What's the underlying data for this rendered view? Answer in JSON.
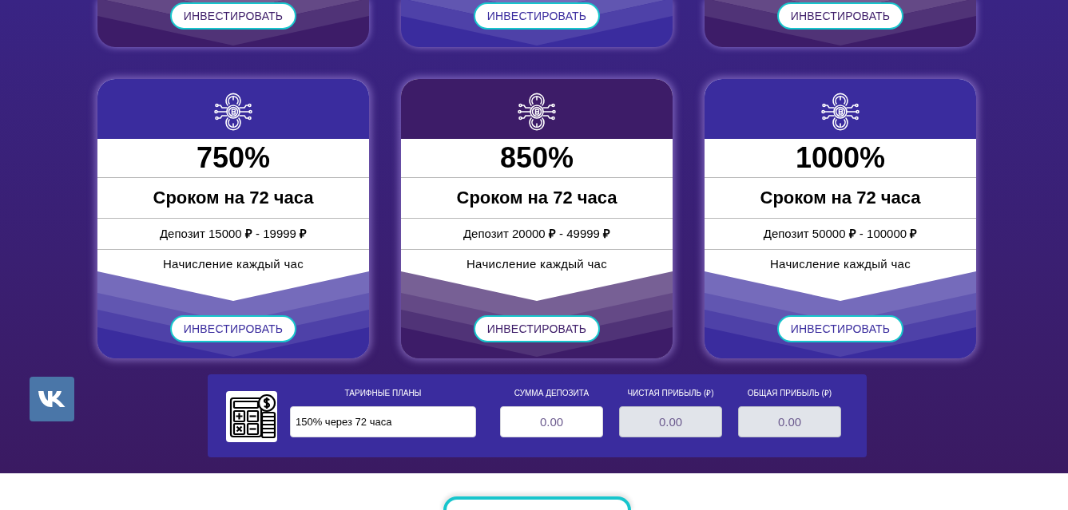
{
  "top_plans": [
    {
      "color": "#3d1c68",
      "button": "ИНВЕСТИРОВАТЬ"
    },
    {
      "color": "#3a2c9e",
      "button": "ИНВЕСТИРОВАТЬ"
    },
    {
      "color": "#3d1c68",
      "button": "ИНВЕСТИРОВАТЬ"
    }
  ],
  "plans": [
    {
      "color": "#3a2c9e",
      "percent": "750%",
      "term": "Сроком на 72 часа",
      "deposit": "Депозит 15000 **₽** - 19999 **₽**",
      "accrual": "Начисление каждый час",
      "button": "ИНВЕСТИРОВАТЬ"
    },
    {
      "color": "#3d1c68",
      "percent": "850%",
      "term": "Сроком на 72 часа",
      "deposit": "Депозит 20000 **₽** - 49999 **₽**",
      "accrual": "Начисление каждый час",
      "button": "ИНВЕСТИРОВАТЬ"
    },
    {
      "color": "#3a2c9e",
      "percent": "1000%",
      "term": "Сроком на 72 часа",
      "deposit": "Депозит 50000 **₽** - 100000 **₽**",
      "accrual": "Начисление каждый час",
      "button": "ИНВЕСТИРОВАТЬ"
    }
  ],
  "calculator": {
    "fields": [
      {
        "kind": "select",
        "label": "ТАРИФНЫЕ ПЛАНЫ",
        "value": "150% через 72 часа",
        "readonly": false
      },
      {
        "kind": "input",
        "label": "СУММА ДЕПОЗИТА",
        "value": "0.00",
        "readonly": false
      },
      {
        "kind": "input",
        "label": "ЧИСТАЯ ПРИБЫЛЬ (₽)",
        "value": "0.00",
        "readonly": true
      },
      {
        "kind": "input",
        "label": "ОБЩАЯ ПРИБЫЛЬ (₽)",
        "value": "0.00",
        "readonly": true
      }
    ]
  }
}
